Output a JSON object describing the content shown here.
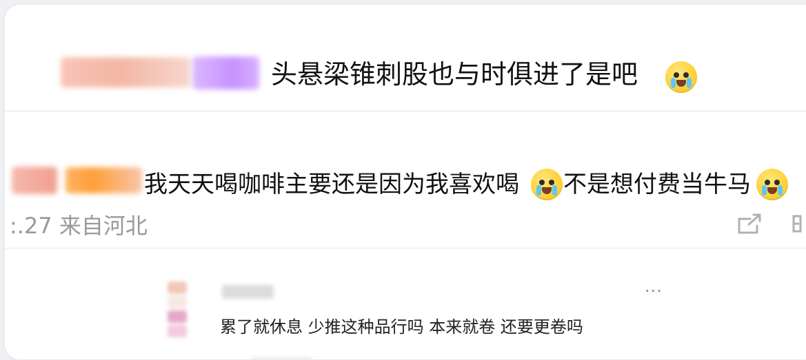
{
  "comments": [
    {
      "text": "头悬梁锥刺股也与时俱进了是吧"
    },
    {
      "text": "我天天喝咖啡主要还是因为我喜欢喝",
      "text_after_emoji": "不是想付费当牛马"
    }
  ],
  "meta": {
    "time_location": ":.27 来自河北"
  },
  "reply": {
    "text": "累了就休息 少推这种品行吗 本来就卷 还要更卷吗",
    "more_label": "···"
  },
  "icons": {
    "emoji": "crying-face-icon",
    "share": "share-icon",
    "side": "side-action-icon"
  },
  "colors": {
    "card_background": "#ffffff",
    "page_background": "#eef0f3",
    "divider": "#e6e6e6",
    "primary_text": "#111111",
    "secondary_text": "#999999"
  }
}
